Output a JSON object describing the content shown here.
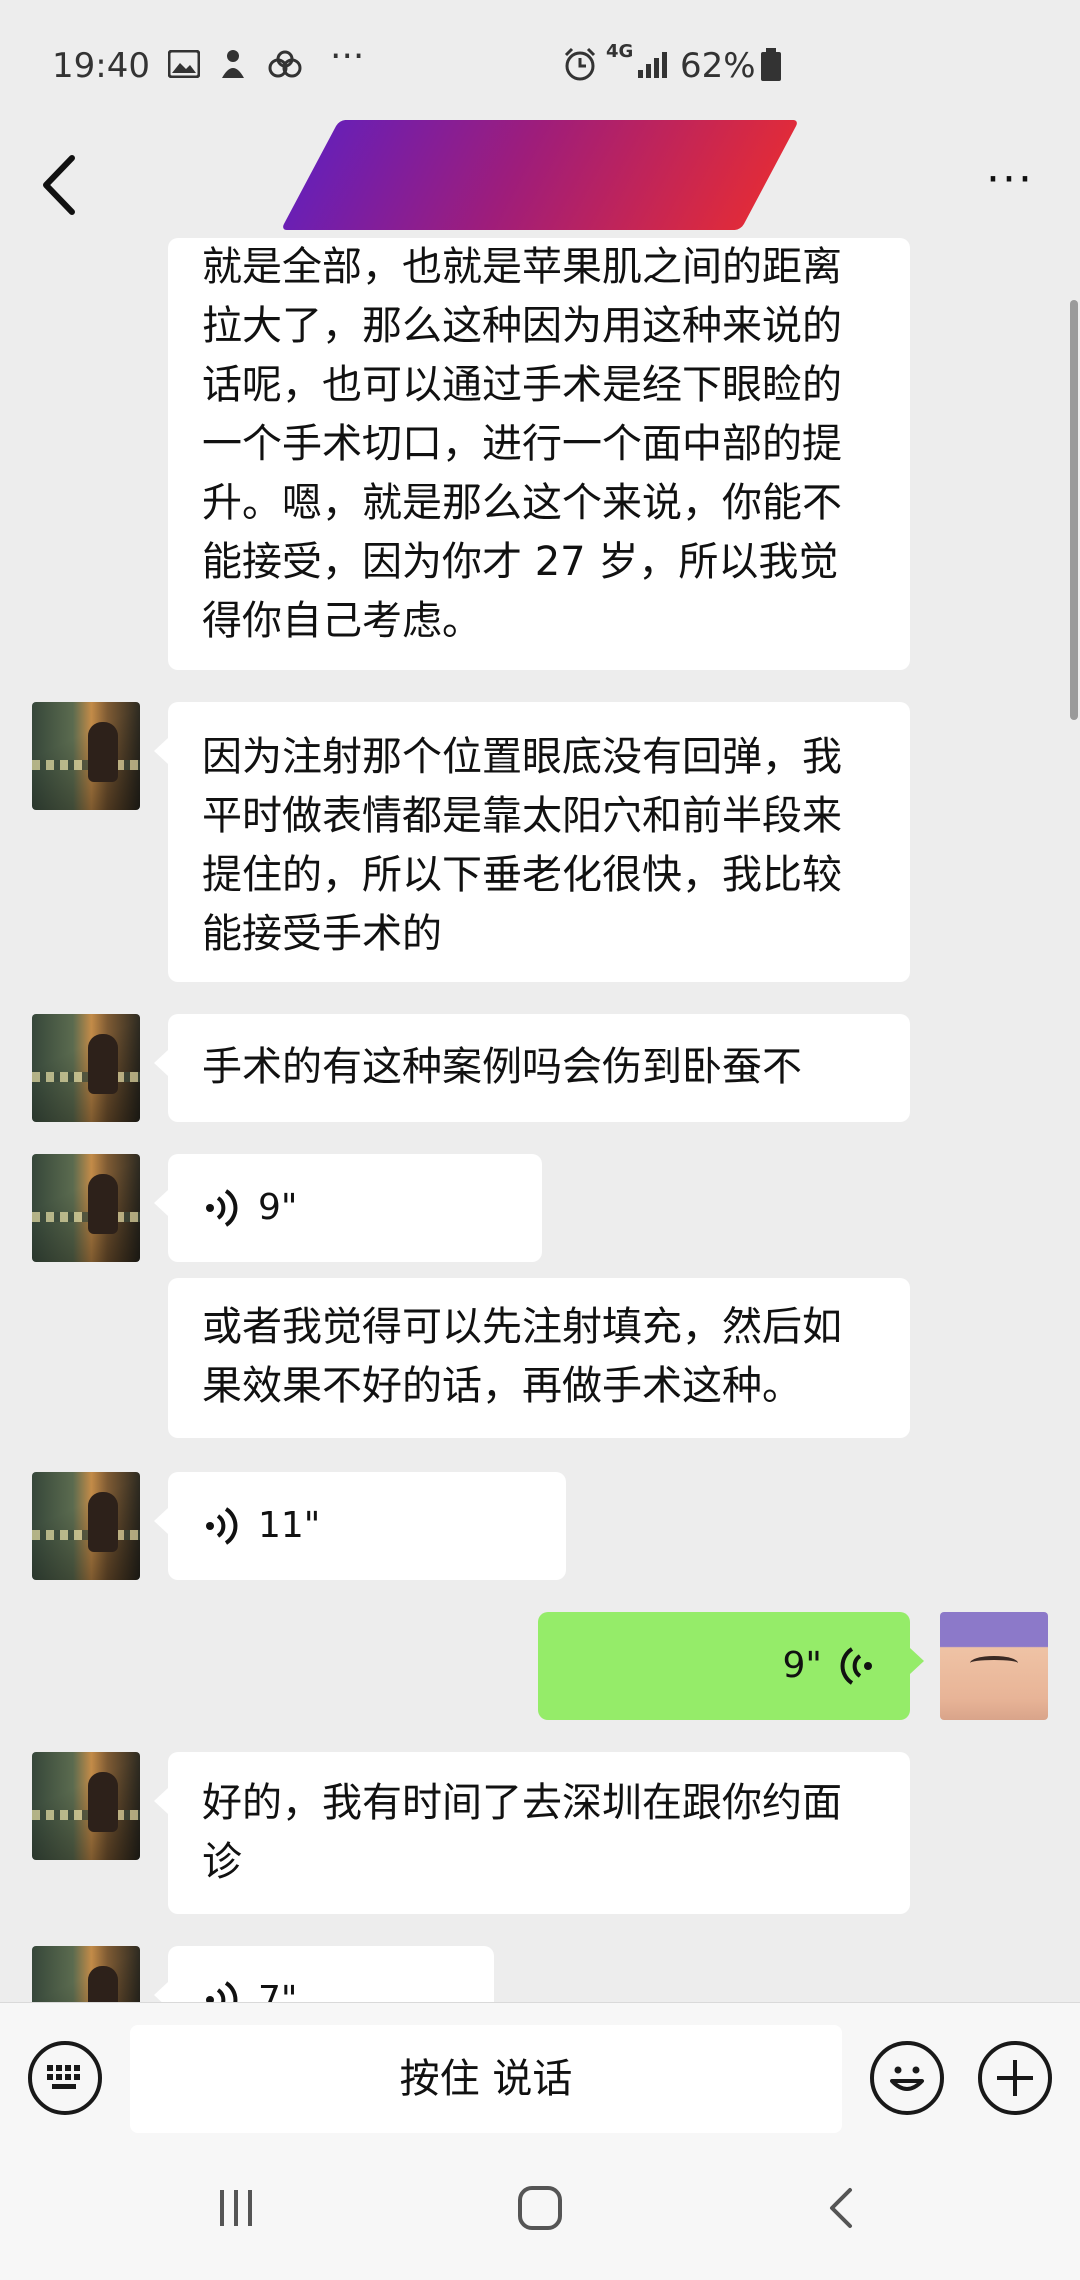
{
  "status": {
    "time": "19:40",
    "battery": "62%",
    "network": "4G"
  },
  "header": {
    "more_label": "···"
  },
  "messages": [
    {
      "text": "就是全部，也就是苹果肌之间的距离拉大了，那么这种因为用这种来说的话呢，也可以通过手术是经下眼睑的一个手术切口，进行一个面中部的提升。嗯，就是那么这个来说，你能不能接受，因为你才 27 岁，所以我觉得你自己考虑。"
    },
    {
      "text": "因为注射那个位置眼底没有回弹，我平时做表情都是靠太阳穴和前半段来提住的，所以下垂老化很快，我比较能接受手术的"
    },
    {
      "text": "手术的有这种案例吗会伤到卧蚕不"
    },
    {
      "duration": "9\""
    },
    {
      "text": "或者我觉得可以先注射填充，然后如果效果不好的话，再做手术这种。"
    },
    {
      "duration": "11\""
    },
    {
      "duration": "9\""
    },
    {
      "text": "好的，我有时间了去深圳在跟你约面诊"
    },
    {
      "duration": "7\""
    }
  ],
  "input": {
    "hold_to_talk": "按住 说话"
  }
}
